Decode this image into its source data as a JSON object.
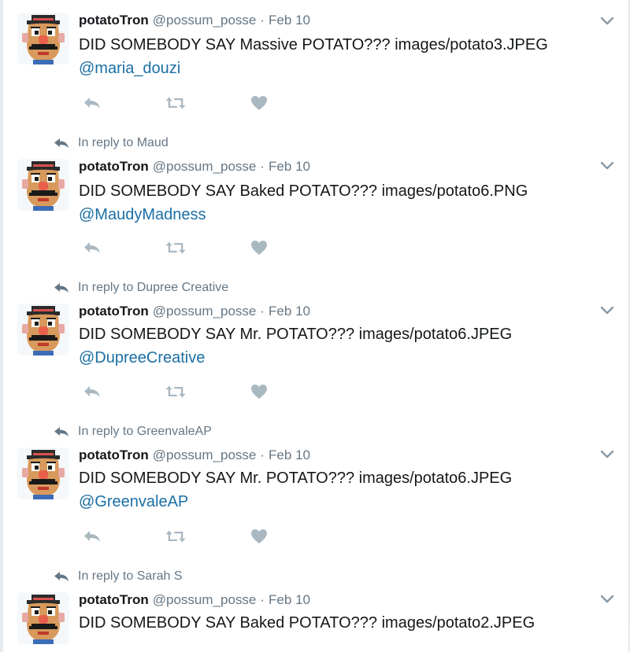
{
  "colors": {
    "link": "#1b6fa5",
    "muted": "#657786",
    "icon": "#aab8c2",
    "border": "#e1e8ed"
  },
  "icons": {
    "reply_context": "reply-arrow-icon",
    "caret": "chevron-down-icon",
    "reply": "reply-icon",
    "retweet": "retweet-icon",
    "like": "heart-icon",
    "avatar": "mr-potato-head-avatar"
  },
  "tweets": [
    {
      "reply_to": "",
      "name": "potatoTron",
      "handle": "@possum_posse",
      "separator": "·",
      "time": "Feb 10",
      "text": "DID SOMEBODY SAY Massive POTATO??? images/potato3.JPEG",
      "mention": "@maria_douzi"
    },
    {
      "reply_to": "In reply to Maud",
      "name": "potatoTron",
      "handle": "@possum_posse",
      "separator": "·",
      "time": "Feb 10",
      "text": "DID SOMEBODY SAY Baked POTATO??? images/potato6.PNG",
      "mention": "@MaudyMadness"
    },
    {
      "reply_to": "In reply to Dupree Creative",
      "name": "potatoTron",
      "handle": "@possum_posse",
      "separator": "·",
      "time": "Feb 10",
      "text": "DID SOMEBODY SAY Mr. POTATO??? images/potato6.JPEG",
      "mention": "@DupreeCreative"
    },
    {
      "reply_to": "In reply to GreenvaleAP",
      "name": "potatoTron",
      "handle": "@possum_posse",
      "separator": "·",
      "time": "Feb 10",
      "text": "DID SOMEBODY SAY Mr. POTATO??? images/potato6.JPEG",
      "mention": "@GreenvaleAP"
    },
    {
      "reply_to": "In reply to Sarah S",
      "name": "potatoTron",
      "handle": "@possum_posse",
      "separator": "·",
      "time": "Feb 10",
      "text": "DID SOMEBODY SAY Baked POTATO??? images/potato2.JPEG",
      "mention": ""
    }
  ]
}
